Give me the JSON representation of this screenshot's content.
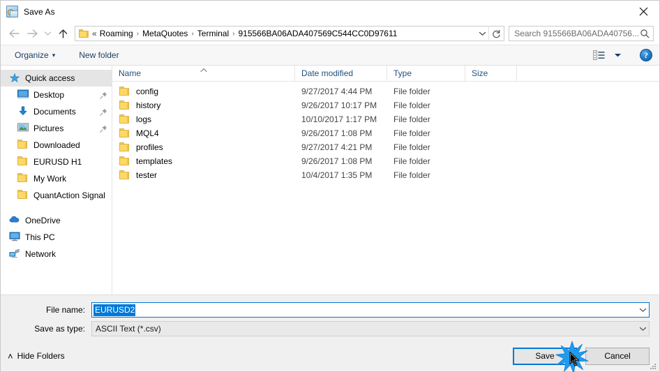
{
  "window": {
    "title": "Save As",
    "app_icon": "save-as-app-icon",
    "close_label": "✕"
  },
  "navigation": {
    "back_icon": "back-arrow-icon",
    "forward_icon": "forward-arrow-icon",
    "recent_icon": "recent-locations-chevron-icon",
    "up_icon": "up-arrow-icon",
    "breadcrumb": {
      "folder_icon": "folder-icon",
      "overflow": "«",
      "items": [
        "Roaming",
        "MetaQuotes",
        "Terminal",
        "915566BA06ADA407569C544CC0D97611"
      ],
      "separator": "›",
      "dropdown_icon": "chevron-down-icon"
    },
    "refresh_icon": "refresh-icon"
  },
  "search": {
    "placeholder": "Search 915566BA06ADA40756...",
    "value": "",
    "icon": "search-icon"
  },
  "toolbar": {
    "organize_label": "Organize",
    "organize_caret": "▾",
    "new_folder_label": "New folder",
    "view_icon": "view-layout-icon",
    "view_caret": "▾",
    "help_label": "?",
    "help_icon": "help-icon"
  },
  "sidebar": {
    "items": [
      {
        "label": "Quick access",
        "icon": "quick-access-star-icon",
        "selected": true,
        "level": 0,
        "pinned": false
      },
      {
        "label": "Desktop",
        "icon": "desktop-icon",
        "selected": false,
        "level": 1,
        "pinned": true
      },
      {
        "label": "Documents",
        "icon": "documents-download-icon",
        "selected": false,
        "level": 1,
        "pinned": true
      },
      {
        "label": "Pictures",
        "icon": "pictures-icon",
        "selected": false,
        "level": 1,
        "pinned": true
      },
      {
        "label": "Downloaded",
        "icon": "folder-icon",
        "selected": false,
        "level": 1,
        "pinned": false
      },
      {
        "label": "EURUSD H1",
        "icon": "folder-icon",
        "selected": false,
        "level": 1,
        "pinned": false
      },
      {
        "label": "My Work",
        "icon": "folder-icon",
        "selected": false,
        "level": 1,
        "pinned": false
      },
      {
        "label": "QuantAction Signal",
        "icon": "folder-icon",
        "selected": false,
        "level": 1,
        "pinned": false
      },
      {
        "label": "OneDrive",
        "icon": "onedrive-cloud-icon",
        "selected": false,
        "level": 0,
        "pinned": false,
        "spacer_before": true
      },
      {
        "label": "This PC",
        "icon": "this-pc-monitor-icon",
        "selected": false,
        "level": 0,
        "pinned": false
      },
      {
        "label": "Network",
        "icon": "network-icon",
        "selected": false,
        "level": 0,
        "pinned": false
      }
    ]
  },
  "file_list": {
    "columns": [
      "Name",
      "Date modified",
      "Type",
      "Size"
    ],
    "sort_column": "Name",
    "sort_direction": "ascending",
    "rows": [
      {
        "name": "config",
        "date": "9/27/2017 4:44 PM",
        "type": "File folder",
        "size": ""
      },
      {
        "name": "history",
        "date": "9/26/2017 10:17 PM",
        "type": "File folder",
        "size": ""
      },
      {
        "name": "logs",
        "date": "10/10/2017 1:17 PM",
        "type": "File folder",
        "size": ""
      },
      {
        "name": "MQL4",
        "date": "9/26/2017 1:08 PM",
        "type": "File folder",
        "size": ""
      },
      {
        "name": "profiles",
        "date": "9/27/2017 4:21 PM",
        "type": "File folder",
        "size": ""
      },
      {
        "name": "templates",
        "date": "9/26/2017 1:08 PM",
        "type": "File folder",
        "size": ""
      },
      {
        "name": "tester",
        "date": "10/4/2017 1:35 PM",
        "type": "File folder",
        "size": ""
      }
    ]
  },
  "form": {
    "filename_label": "File name:",
    "filename_value": "EURUSD2",
    "filename_selected": true,
    "filetype_label": "Save as type:",
    "filetype_value": "ASCII Text (*.csv)",
    "dropdown_icon": "chevron-down-icon"
  },
  "footer": {
    "hide_folders_label": "Hide Folders",
    "hide_folders_caret": "˄",
    "save_label": "Save",
    "cancel_label": "Cancel",
    "save_focused": true,
    "resize_grip_icon": "resize-grip-icon",
    "click_effect_icon": "click-starburst-icon",
    "cursor_icon": "mouse-cursor-icon"
  },
  "colors": {
    "accent": "#0078d7",
    "selection": "#e5e5e5",
    "header_text": "#24507f",
    "folder_yellow": "#ffd966",
    "toolbar_bg": "#f7f7f7",
    "form_bg": "#f0f0f0"
  }
}
